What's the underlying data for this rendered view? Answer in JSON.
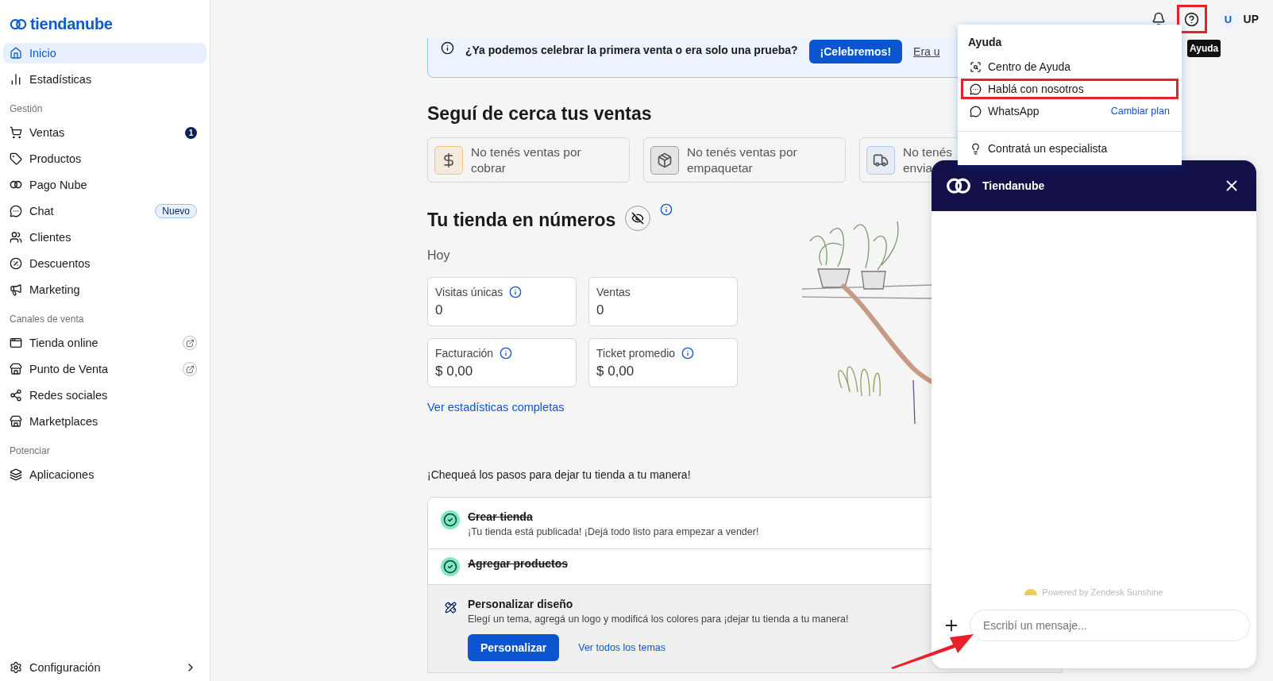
{
  "sidebar": {
    "logo": "tiendanube",
    "groups": [
      {
        "items": [
          {
            "label": "Inicio",
            "selected": true
          },
          {
            "label": "Estadísticas",
            "selected": false
          }
        ]
      },
      {
        "heading": "Gestión",
        "items": [
          {
            "label": "Ventas",
            "selected": false,
            "badge": {
              "kind": "count",
              "text": "1"
            }
          },
          {
            "label": "Productos",
            "selected": false
          },
          {
            "label": "Pago Nube",
            "selected": false
          },
          {
            "label": "Chat",
            "selected": false,
            "badge": {
              "kind": "pill",
              "text": "Nuevo"
            }
          },
          {
            "label": "Clientes",
            "selected": false
          },
          {
            "label": "Descuentos",
            "selected": false
          },
          {
            "label": "Marketing",
            "selected": false
          }
        ]
      },
      {
        "heading": "Canales de venta",
        "items": [
          {
            "label": "Tienda online",
            "selected": false,
            "external": true
          },
          {
            "label": "Punto de Venta",
            "selected": false,
            "external": true
          },
          {
            "label": "Redes sociales",
            "selected": false
          },
          {
            "label": "Marketplaces",
            "selected": false
          }
        ]
      },
      {
        "heading": "Potenciar",
        "items": [
          {
            "label": "Aplicaciones",
            "selected": false
          }
        ]
      }
    ],
    "footer": {
      "label": "Configuración"
    }
  },
  "header": {
    "help_highlighted": true,
    "avatar": "U",
    "user": "UP",
    "tooltip": "Ayuda"
  },
  "banner": {
    "text": "¿Ya podemos celebrar la primera venta o era solo una prueba?",
    "button": "¡Celebremos!",
    "link": "Era u"
  },
  "sales": {
    "title": "Seguí de cerca tus ventas",
    "cards": [
      {
        "lines": [
          "No tenés ventas por",
          "cobrar"
        ],
        "color": "#f3c27a"
      },
      {
        "lines": [
          "No tenés ventas por",
          "empaquetar"
        ],
        "color": "#a0a0a0"
      },
      {
        "lines": [
          "No tenés",
          "envia"
        ],
        "color": "#a9c7f2"
      }
    ]
  },
  "stats": {
    "title": "Tu tienda en números",
    "period": "Hoy",
    "items": [
      {
        "label": "Visitas únicas",
        "value": "0",
        "info": true
      },
      {
        "label": "Ventas",
        "value": "0",
        "info": false
      },
      {
        "label": "Facturación",
        "value": "$ 0,00",
        "info": true
      },
      {
        "label": "Ticket promedio",
        "value": "$ 0,00",
        "info": true
      }
    ],
    "link": "Ver estadísticas completas"
  },
  "checklist": {
    "title": "¡Chequeá los pasos para dejar tu tienda a tu manera!",
    "steps": [
      {
        "title": "Crear tienda",
        "description": "¡Tu tienda está publicada! ¡Dejá todo listo para empezar a vender!",
        "done": true,
        "active": false
      },
      {
        "title": "Agregar productos",
        "done": true,
        "active": false
      },
      {
        "title": "Personalizar diseño",
        "description": "Elegí un tema, agregá un logo y modificá los colores para ¡dejar tu tienda a tu manera!",
        "done": false,
        "active": true,
        "button": "Personalizar",
        "link": "Ver todos los temas"
      }
    ]
  },
  "help_menu": {
    "title": "Ayuda",
    "items": [
      {
        "label": "Centro de Ayuda",
        "highlighted": false
      },
      {
        "label": "Hablá con nosotros",
        "highlighted": true
      },
      {
        "label": "WhatsApp",
        "highlighted": false,
        "link": "Cambiar plan"
      },
      {
        "label": "Contratá un especialista",
        "highlighted": false,
        "divider_before": true
      }
    ]
  },
  "chat": {
    "title": "Tiendanube",
    "powered_by": "Powered by Zendesk Sunshine",
    "placeholder": "Escribí un mensaje...",
    "pointer_arrow": true
  }
}
